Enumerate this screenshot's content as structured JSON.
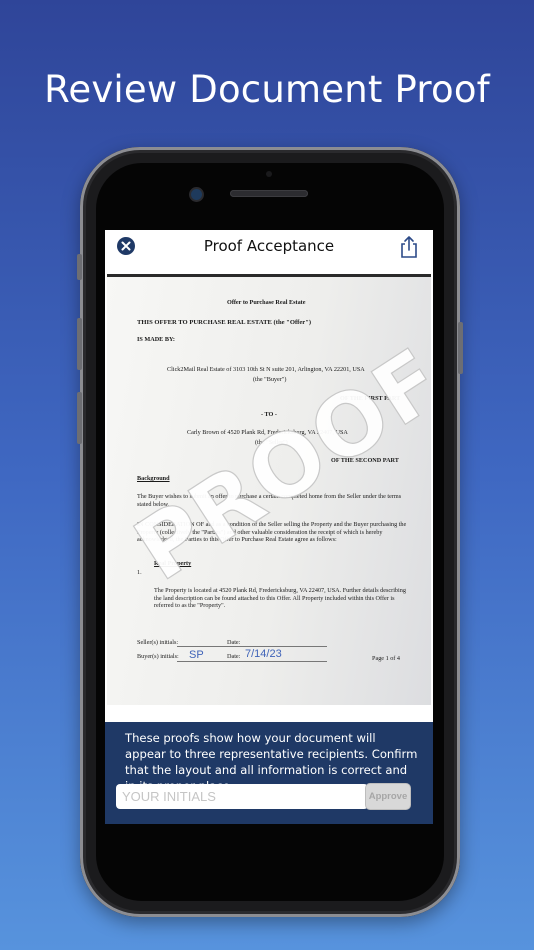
{
  "headline": "Review Document Proof",
  "navbar": {
    "title": "Proof Acceptance",
    "close_icon": "close-circle-icon",
    "share_icon": "share-icon"
  },
  "document": {
    "heading": "Offer to Purchase Real Estate",
    "line1": "THIS OFFER TO PURCHASE REAL ESTATE (the \"Offer\")",
    "line2": "IS MADE BY:",
    "buyer_address": "Click2Mail Real Estate of 3103 10th St N suite 201, Arlington, VA 22201, USA",
    "buyer_role": "(the \"Buyer\")",
    "first_part": "OF THE FIRST PART",
    "to": "- TO -",
    "seller_address": "Carly Brown of 4520 Plank Rd, Fredericksburg, VA 22407, USA",
    "seller_role": "(the \"Seller\")",
    "second_part": "OF THE SECOND PART",
    "background_heading": "Background",
    "background_text": "The Buyer wishes to submit an offer to purchase a certain completed home from the Seller under the terms stated below.",
    "consideration_text": "IN CONSIDERATION OF and as a condition of the Seller selling the Property and the Buyer purchasing the Property (collectively the \"Parties\") and other valuable consideration the receipt of which is hereby acknowledged, the Parties to this Offer to Purchase Real Estate agree as follows:",
    "section_heading": "Real Property",
    "section_number": "1.",
    "property_text": "The Property is located at 4520 Plank Rd, Fredericksburg, VA 22407, USA. Further details describing the land description can be found attached to this Offer. All Property included within this Offer is referred to as the \"Property\".",
    "seller_initials_label": "Seller(s) initials:",
    "buyer_initials_label": "Buyer(s) initials:",
    "date_label": "Date:",
    "buyer_initials_value": "SP",
    "date_value": "7/14/23",
    "page_label": "Page 1 of 4",
    "watermark": "PROOF"
  },
  "panel": {
    "message": "These proofs show how your document will appear to three representative recipients. Confirm that the layout and all information is correct and in its proper place.",
    "initials_placeholder": "YOUR INITIALS",
    "approve_label": "Approve"
  },
  "colors": {
    "panel": "#1f3966",
    "background_top": "#2f4599",
    "background_bottom": "#5793dd"
  }
}
